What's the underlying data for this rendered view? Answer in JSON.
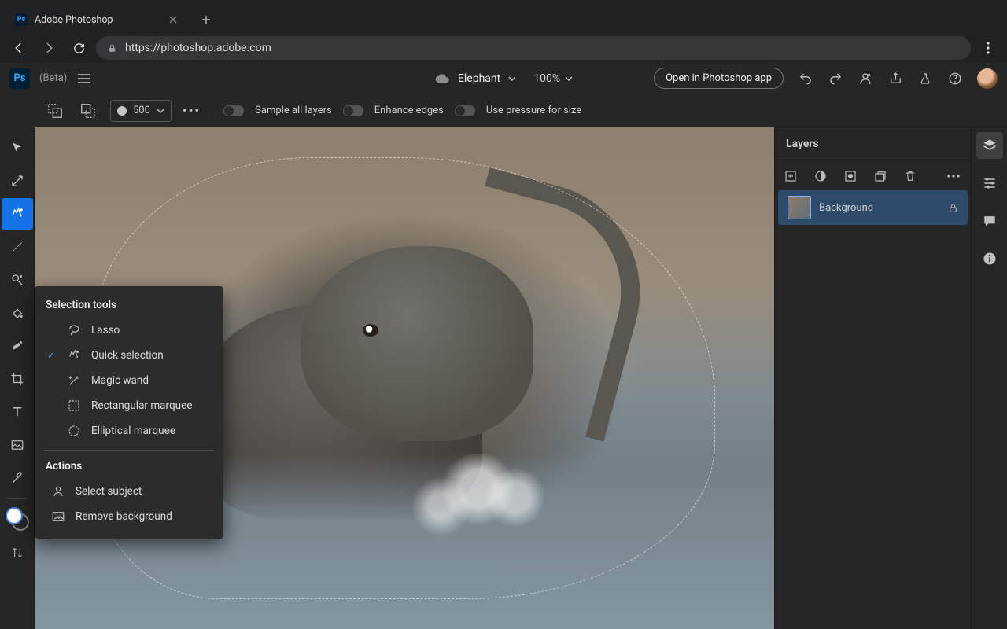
{
  "browser": {
    "tab_title": "Adobe Photoshop",
    "url": "https://photoshop.adobe.com"
  },
  "header": {
    "logo_text": "Ps",
    "beta_label": "(Beta)",
    "document_name": "Elephant",
    "zoom": "100%",
    "open_in_app": "Open in Photoshop app"
  },
  "options_bar": {
    "brush_size": "500",
    "sample_all_layers": "Sample all layers",
    "enhance_edges": "Enhance edges",
    "use_pressure": "Use pressure for size"
  },
  "flyout": {
    "heading_tools": "Selection tools",
    "items": [
      {
        "label": "Lasso"
      },
      {
        "label": "Quick selection"
      },
      {
        "label": "Magic wand"
      },
      {
        "label": "Rectangular marquee"
      },
      {
        "label": "Elliptical marquee"
      }
    ],
    "heading_actions": "Actions",
    "actions": [
      {
        "label": "Select subject"
      },
      {
        "label": "Remove background"
      }
    ],
    "selected": "Quick selection"
  },
  "layers_panel": {
    "title": "Layers",
    "items": [
      {
        "name": "Background",
        "locked": true
      }
    ]
  },
  "colors": {
    "accent": "#1473e6",
    "foreground_swatch": "#ffffff",
    "background_swatch": "#000000"
  }
}
